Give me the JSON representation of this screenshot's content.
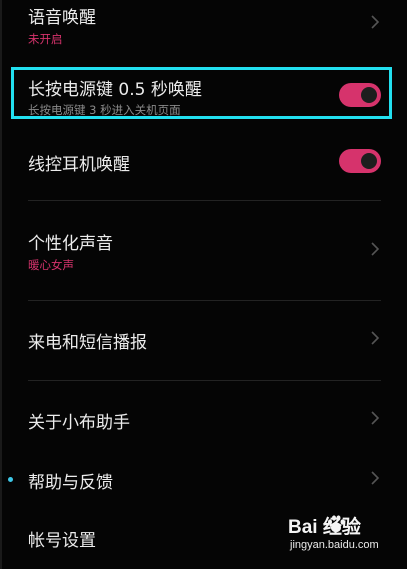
{
  "settings": {
    "items": [
      {
        "title": "语音唤醒",
        "subtitle": "未开启",
        "control": "chevron-right"
      },
      {
        "title": "长按电源键 0.5 秒唤醒",
        "subtitle": "长按电源键 3 秒进入关机页面",
        "control": "toggle",
        "toggle_on": true,
        "highlighted": true
      },
      {
        "title": "线控耳机唤醒",
        "control": "toggle",
        "toggle_on": true
      },
      {
        "title": "个性化声音",
        "subtitle": "暖心女声",
        "control": "chevron-right"
      },
      {
        "title": "来电和短信播报",
        "control": "chevron-right"
      },
      {
        "title": "关于小布助手",
        "control": "chevron-right"
      },
      {
        "title": "帮助与反馈",
        "control": "chevron-right"
      },
      {
        "title": "帐号设置",
        "control": "chevron-right"
      }
    ]
  },
  "watermark": {
    "logo_text": "Bai  经验",
    "url": "jingyan.baidu.com"
  },
  "colors": {
    "accent": "#d6336c",
    "highlight_border": "#22e0f0",
    "background": "#050505",
    "divider": "#232323"
  }
}
